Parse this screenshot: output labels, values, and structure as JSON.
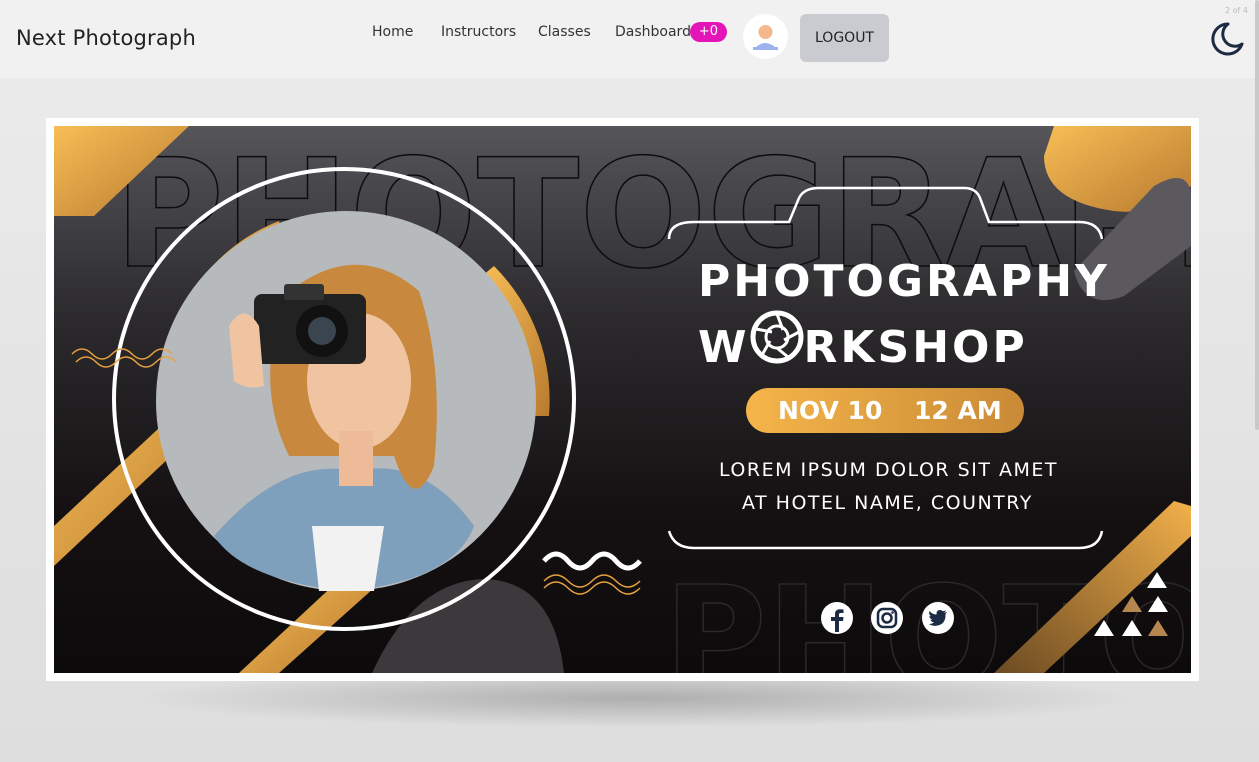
{
  "brand": "Next Photograph",
  "slide_counter": "2 of 4",
  "nav": {
    "links": [
      "Home",
      "Instructors",
      "Classes",
      "Dashboard"
    ],
    "badge": "+0",
    "logout_label": "LOGOUT"
  },
  "banner": {
    "background_words": [
      "PHOTOGRAPHY",
      "PHOTO"
    ],
    "title_line1": "PHOTOGRAPHY",
    "title_line2_prefix": "W",
    "title_line2_suffix": "RKSHOP",
    "date": "NOV 10",
    "time": "12 AM",
    "desc_line1": "LOREM IPSUM DOLOR SIT AMET",
    "desc_line2": "AT HOTEL NAME, COUNTRY",
    "social_icons": [
      "facebook-icon",
      "instagram-icon",
      "twitter-icon"
    ]
  },
  "colors": {
    "accent_gold": "#e9a23f",
    "badge_pink": "#e415b8",
    "banner_dark": "#151113"
  }
}
